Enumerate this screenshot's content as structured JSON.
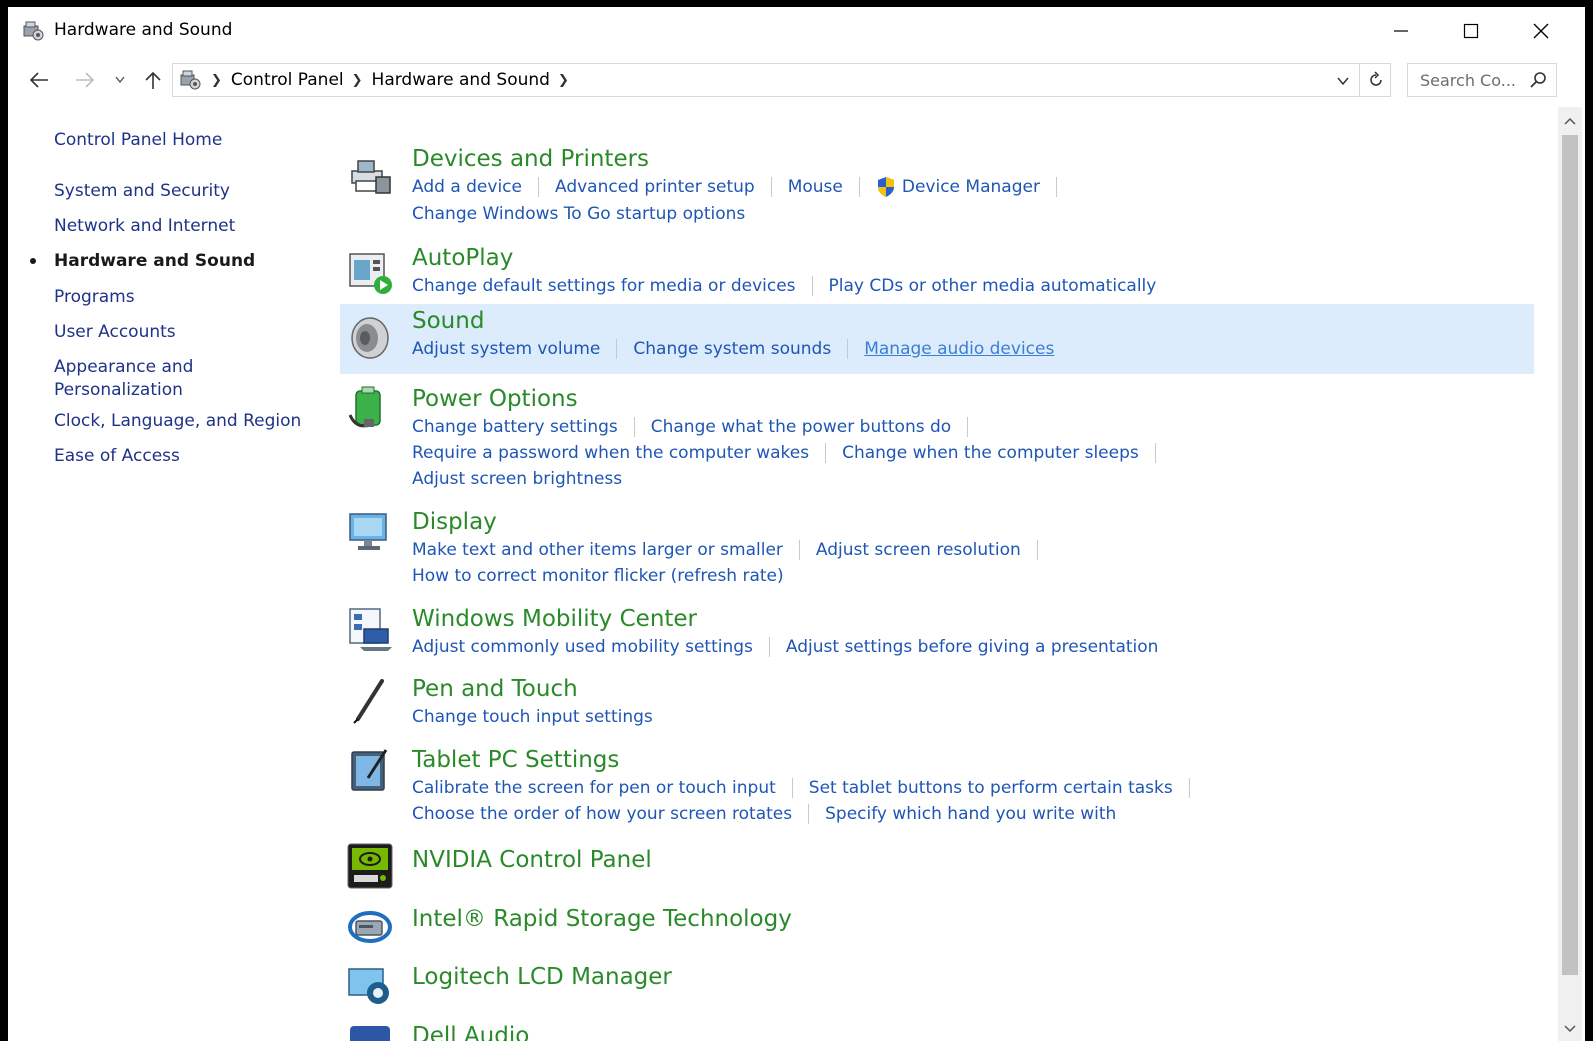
{
  "window": {
    "title": "Hardware and Sound"
  },
  "window_buttons": {
    "minimize": "minimize-icon",
    "maximize": "maximize-icon",
    "close": "close-icon"
  },
  "address_bar": {
    "breadcrumbs": [
      "Control Panel",
      "Hardware and Sound"
    ],
    "search_placeholder": "Search Co..."
  },
  "left_nav": {
    "items": [
      {
        "label": "Control Panel Home",
        "current": false
      },
      {
        "label": "System and Security",
        "current": false
      },
      {
        "label": "Network and Internet",
        "current": false
      },
      {
        "label": "Hardware and Sound",
        "current": true
      },
      {
        "label": "Programs",
        "current": false
      },
      {
        "label": "User Accounts",
        "current": false
      },
      {
        "label": "Appearance and",
        "label2": "Personalization",
        "current": false
      },
      {
        "label": "Clock, Language, and Region",
        "current": false
      },
      {
        "label": "Ease of Access",
        "current": false
      }
    ]
  },
  "categories": [
    {
      "title": "Devices and Printers",
      "icon": "printer-icon",
      "lines": [
        [
          "Add a device",
          "Advanced printer setup",
          "Mouse",
          "Device Manager"
        ],
        [
          "Change Windows To Go startup options"
        ]
      ]
    },
    {
      "title": "AutoPlay",
      "icon": "autoplay-icon",
      "lines": [
        [
          "Change default settings for media or devices",
          "Play CDs or other media automatically"
        ]
      ]
    },
    {
      "title": "Sound",
      "icon": "speaker-icon",
      "lines": [
        [
          "Adjust system volume",
          "Change system sounds",
          "Manage audio devices"
        ]
      ]
    },
    {
      "title": "Power Options",
      "icon": "battery-icon",
      "lines": [
        [
          "Change battery settings",
          "Change what the power buttons do"
        ],
        [
          "Require a password when the computer wakes",
          "Change when the computer sleeps"
        ],
        [
          "Adjust screen brightness"
        ]
      ]
    },
    {
      "title": "Display",
      "icon": "monitor-icon",
      "lines": [
        [
          "Make text and other items larger or smaller",
          "Adjust screen resolution"
        ],
        [
          "How to correct monitor flicker (refresh rate)"
        ]
      ]
    },
    {
      "title": "Windows Mobility Center",
      "icon": "mobility-center-icon",
      "lines": [
        [
          "Adjust commonly used mobility settings",
          "Adjust settings before giving a presentation"
        ]
      ]
    },
    {
      "title": "Pen and Touch",
      "icon": "pen-icon",
      "lines": [
        [
          "Change touch input settings"
        ]
      ]
    },
    {
      "title": "Tablet PC Settings",
      "icon": "tablet-icon",
      "lines": [
        [
          "Calibrate the screen for pen or touch input",
          "Set tablet buttons to perform certain tasks"
        ],
        [
          "Choose the order of how your screen rotates",
          "Specify which hand you write with"
        ]
      ]
    },
    {
      "title": "NVIDIA Control Panel",
      "icon": "nvidia-icon",
      "lines": []
    },
    {
      "title": "Intel® Rapid Storage Technology",
      "icon": "intel-rst-icon",
      "lines": []
    },
    {
      "title": "Logitech LCD Manager",
      "icon": "logitech-lcd-icon",
      "lines": []
    },
    {
      "title": "Dell Audio",
      "icon": "dell-audio-icon",
      "lines": []
    }
  ],
  "colors": {
    "category_title": "#2a8a2a",
    "link": "#1f56b5",
    "hover_highlight": "#dcecfc",
    "nav_link": "#1e3287"
  }
}
